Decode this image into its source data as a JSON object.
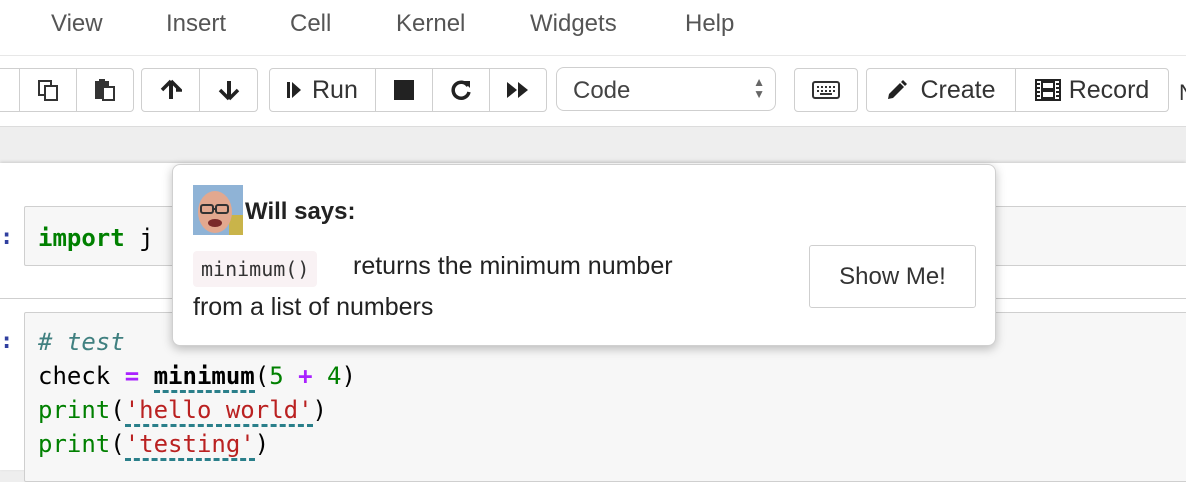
{
  "menu": {
    "items": [
      {
        "label": "View"
      },
      {
        "label": "Insert"
      },
      {
        "label": "Cell"
      },
      {
        "label": "Kernel"
      },
      {
        "label": "Widgets"
      },
      {
        "label": "Help"
      }
    ]
  },
  "toolbar": {
    "run_label": "Run",
    "cell_type": "Code",
    "create_label": "Create",
    "record_label": "Record",
    "truncated_text": "N"
  },
  "cells": {
    "first": {
      "prompt": ":",
      "keyword": "import",
      "rest": " j"
    },
    "second": {
      "prompt": ":",
      "comment": "# test",
      "line2": {
        "var": "check ",
        "op": "=",
        "sp": " ",
        "func": "minimum",
        "open": "(",
        "n1": "5",
        "sp2": " ",
        "plus": "+",
        "sp3": " ",
        "n2": "4",
        "close": ")"
      },
      "line3": {
        "func": "print",
        "open": "(",
        "str": "'hello world'",
        "close": ")"
      },
      "line4": {
        "func": "print",
        "open": "(",
        "str": "'testing'",
        "close": ")"
      }
    }
  },
  "tooltip": {
    "title": "Will says:",
    "code": "minimum()",
    "line1": "returns the minimum number",
    "line2": "from a list of numbers",
    "button": "Show Me!"
  },
  "colors": {
    "keyword": "#008000",
    "string": "#ba2121",
    "operator": "#aa22ff",
    "comment": "#408080",
    "prompt": "#303f9f",
    "dash_underline": "#2a7f8a"
  },
  "icons": {
    "copy": "copy-icon",
    "paste": "paste-icon",
    "move_up": "arrow-up-icon",
    "move_down": "arrow-down-icon",
    "run": "step-forward-icon",
    "stop": "stop-icon",
    "restart": "redo-icon",
    "run_all": "fast-forward-icon",
    "keyboard": "keyboard-icon",
    "create": "pencil-icon",
    "record": "film-icon"
  }
}
